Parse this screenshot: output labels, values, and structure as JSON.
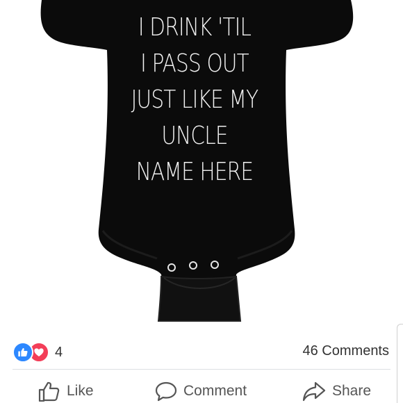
{
  "post": {
    "image": {
      "shirt_lines": [
        "I DRINK 'TIL",
        "I PASS OUT",
        "JUST LIKE MY",
        "UNCLE",
        "NAME HERE"
      ],
      "shirt_color": "#0b0b0b",
      "text_color": "#f2f2f2"
    },
    "reactions": {
      "icons": [
        "like-icon",
        "love-icon"
      ],
      "count": "4"
    },
    "comments_label": "46 Comments",
    "actions": {
      "like_label": "Like",
      "comment_label": "Comment",
      "share_label": "Share"
    },
    "colors": {
      "like_blue": "#2d88ff",
      "love_red": "#f33e58",
      "action_gray": "#555555"
    }
  }
}
